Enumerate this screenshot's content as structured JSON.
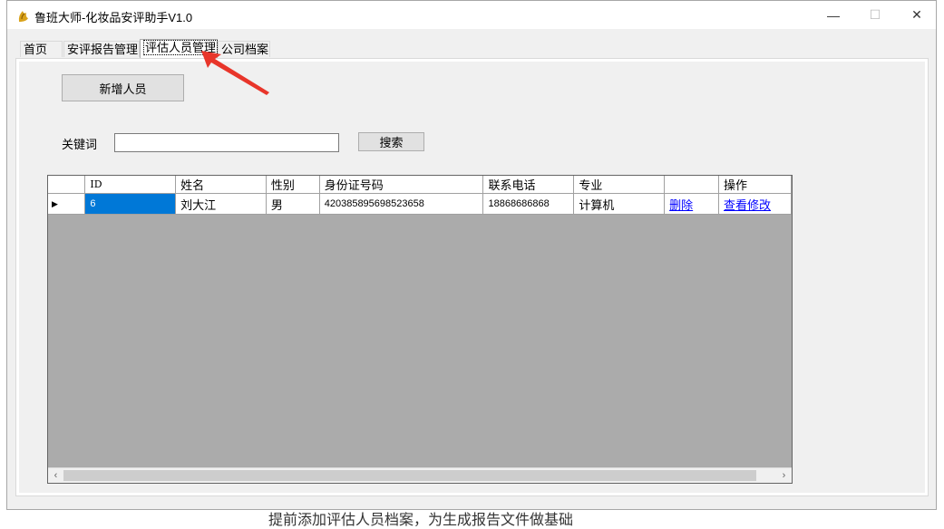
{
  "window": {
    "title": "鲁班大师-化妆品安评助手V1.0",
    "controls": {
      "minimize": "—",
      "maximize": "☐",
      "close": "✕"
    }
  },
  "tabs": [
    {
      "label": "首页"
    },
    {
      "label": "安评报告管理"
    },
    {
      "label": "评估人员管理"
    },
    {
      "label": "公司档案"
    }
  ],
  "active_tab": "评估人员管理",
  "toolbar": {
    "add_person_label": "新增人员"
  },
  "search": {
    "keyword_label": "关键词",
    "keyword_value": "",
    "search_label": "搜索"
  },
  "grid": {
    "columns": [
      "ID",
      "姓名",
      "性别",
      "身份证号码",
      "联系电话",
      "专业",
      "",
      "操作"
    ],
    "rows": [
      {
        "id": "6",
        "name": "刘大江",
        "gender": "男",
        "id_number": "420385895698523658",
        "phone": "18868686868",
        "major": "计算机",
        "delete_link": "删除",
        "edit_link": "查看修改"
      }
    ],
    "row_indicator": "▶",
    "scroll_left": "‹",
    "scroll_right": "›"
  },
  "background_text": "提前添加评估人员档案，为生成报告文件做基础",
  "colors": {
    "selection": "#0078d7",
    "annotation_arrow": "#e8352a",
    "grid_background": "#ababab"
  }
}
